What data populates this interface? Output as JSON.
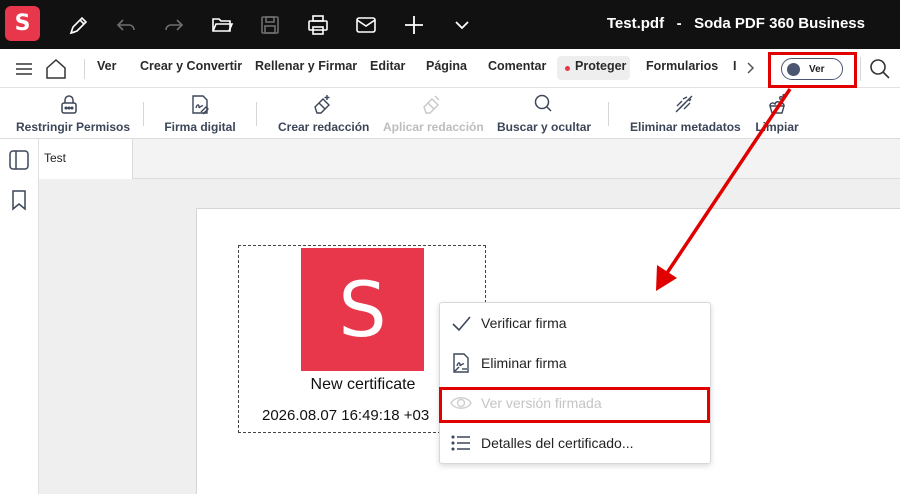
{
  "app": {
    "title": "Test.pdf   -   Soda PDF 360 Business",
    "logo_letter": "S",
    "brand_color": "#e8364b"
  },
  "toolbar_icons": [
    "pen-icon",
    "undo-icon",
    "redo-icon",
    "open-folder-icon",
    "save-icon",
    "print-icon",
    "mail-icon",
    "add-icon",
    "chevron-down-icon"
  ],
  "menubar": {
    "items": [
      "Ver",
      "Crear y Convertir",
      "Rellenar y Firmar",
      "Editar",
      "Página",
      "Comentar",
      "Proteger",
      "Formularios",
      "I"
    ],
    "active": "Proteger",
    "toggle_label": "Ver"
  },
  "ribbon": {
    "buttons": [
      {
        "label": "Restringir Permisos",
        "icon": "lock-icon",
        "enabled": true
      },
      {
        "label": "Firma digital",
        "icon": "signature-icon",
        "enabled": true
      },
      {
        "label": "Crear redacción",
        "icon": "eraser-add-icon",
        "enabled": true
      },
      {
        "label": "Aplicar redacción",
        "icon": "eraser-icon",
        "enabled": false
      },
      {
        "label": "Buscar y ocultar",
        "icon": "search-icon",
        "enabled": true
      },
      {
        "label": "Eliminar metadatos",
        "icon": "metadata-remove-icon",
        "enabled": true
      },
      {
        "label": "Limpiar",
        "icon": "clean-icon",
        "enabled": true
      }
    ]
  },
  "tabs": [
    {
      "label": "Test"
    }
  ],
  "signature": {
    "logo_letter": "S",
    "name": "New certificate",
    "date": "2026.08.07 16:49:18 +03"
  },
  "context_menu": {
    "items": [
      {
        "label": "Verificar firma",
        "icon": "check-icon",
        "enabled": true
      },
      {
        "label": "Eliminar firma",
        "icon": "signature-remove-icon",
        "enabled": true
      },
      {
        "label": "Ver versión firmada",
        "icon": "eye-icon",
        "enabled": false
      },
      {
        "label": "Detalles del certificado...",
        "icon": "list-icon",
        "enabled": true
      }
    ]
  },
  "annotation_color": "#e00000"
}
